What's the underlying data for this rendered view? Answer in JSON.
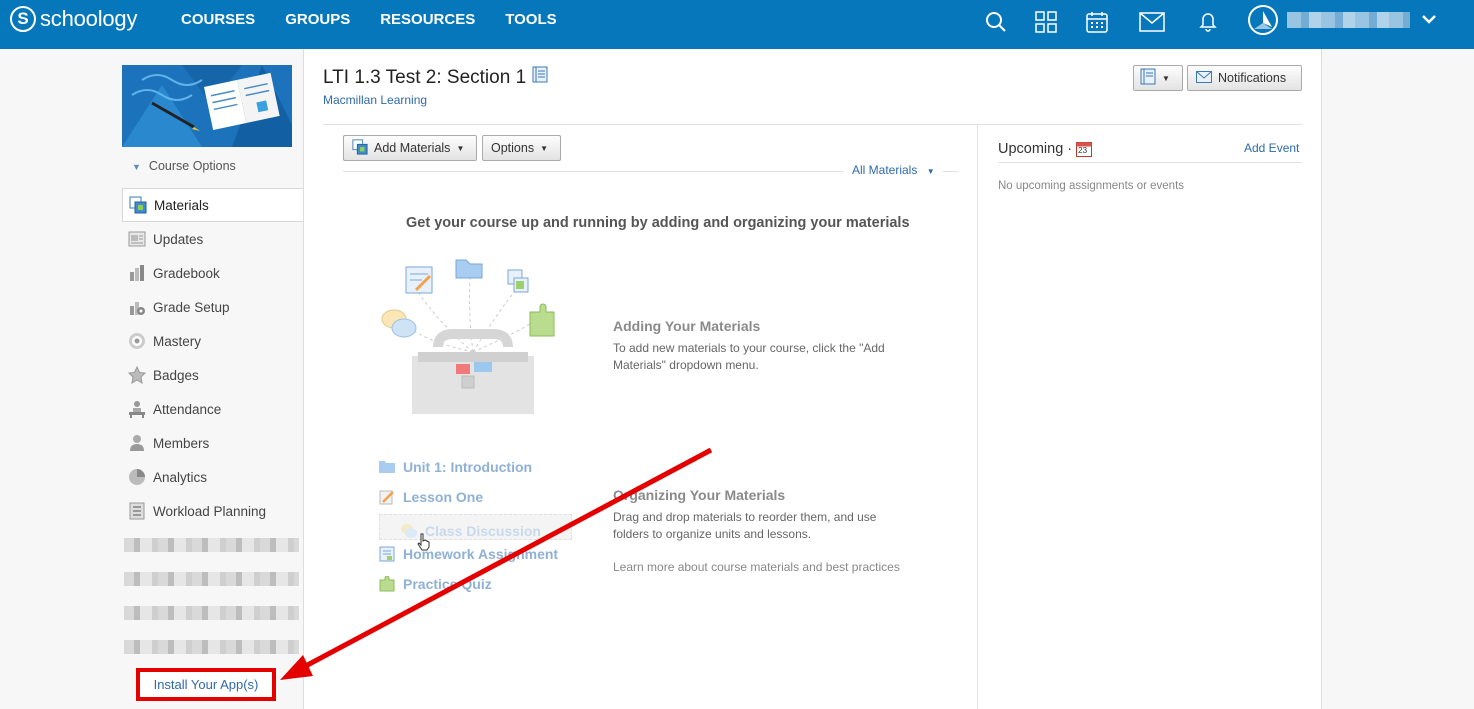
{
  "header": {
    "logo_text": "schoology",
    "logo_letter": "S",
    "nav": [
      "COURSES",
      "GROUPS",
      "RESOURCES",
      "TOOLS"
    ]
  },
  "sidebar": {
    "course_options": "Course Options",
    "items": [
      {
        "label": "Materials",
        "icon": "materials-icon"
      },
      {
        "label": "Updates",
        "icon": "updates-icon"
      },
      {
        "label": "Gradebook",
        "icon": "gradebook-icon"
      },
      {
        "label": "Grade Setup",
        "icon": "grade-setup-icon"
      },
      {
        "label": "Mastery",
        "icon": "mastery-icon"
      },
      {
        "label": "Badges",
        "icon": "badges-icon"
      },
      {
        "label": "Attendance",
        "icon": "attendance-icon"
      },
      {
        "label": "Members",
        "icon": "members-icon"
      },
      {
        "label": "Analytics",
        "icon": "analytics-icon"
      },
      {
        "label": "Workload Planning",
        "icon": "workload-planning-icon"
      }
    ],
    "install_apps": "Install Your App(s)"
  },
  "main": {
    "title": "LTI 1.3 Test 2: Section 1",
    "subtitle": "Macmillan Learning",
    "notifications_button": "Notifications",
    "add_materials_button": "Add Materials",
    "options_button": "Options",
    "filter": "All Materials",
    "empty_headline": "Get your course up and running by adding and organizing your materials",
    "adding_title": "Adding Your Materials",
    "adding_text_1": "To add new materials to your course, click the \"Add",
    "adding_text_2": "Materials\" dropdown menu.",
    "organizing_title": "Organizing Your Materials",
    "organizing_text_1": "Drag and drop materials to reorder them, and use",
    "organizing_text_2": "folders to organize units and lessons.",
    "learn_more": "Learn more about course materials and best practices",
    "sample_materials": [
      "Unit 1: Introduction",
      "Lesson One",
      "Class Discussion",
      "Homework Assignment",
      "Practice Quiz"
    ]
  },
  "right": {
    "upcoming_title": "Upcoming ·",
    "calendar_day": "23",
    "add_event": "Add Event",
    "empty_text": "No upcoming assignments or events"
  },
  "colors": {
    "topbar": "#0677ba",
    "link": "#2f6aad",
    "highlight_box": "#e50000"
  }
}
